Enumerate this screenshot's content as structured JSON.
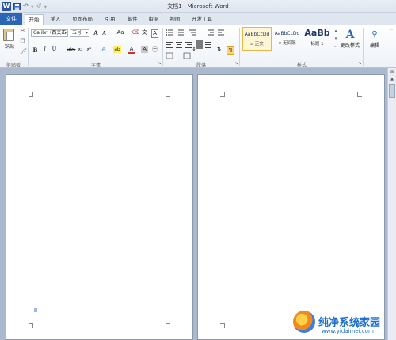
{
  "window": {
    "title": "文档1 - Microsoft Word"
  },
  "qat": {
    "app_icon": "W",
    "undo": "↶",
    "redo": "↺",
    "customize": "▾"
  },
  "tabs": [
    {
      "label": "文件"
    },
    {
      "label": "开始"
    },
    {
      "label": "插入"
    },
    {
      "label": "页面布局"
    },
    {
      "label": "引用"
    },
    {
      "label": "邮件"
    },
    {
      "label": "审阅"
    },
    {
      "label": "视图"
    },
    {
      "label": "开发工具"
    }
  ],
  "ribbon": {
    "clipboard": {
      "paste_label": "粘贴",
      "group_label": "剪贴板"
    },
    "font": {
      "font_name": "Calibri (西文正",
      "font_size": "五号",
      "grow": "A",
      "shrink": "A",
      "change_case": "Aa",
      "clear_format": "⌫",
      "phonetic": "文",
      "border_char": "A",
      "bold": "B",
      "italic": "I",
      "underline": "U",
      "strike": "abc",
      "subscript": "x₂",
      "superscript": "x²",
      "text_effect": "A",
      "highlight": "ab",
      "font_color": "A",
      "char_shading": "A",
      "enclose": "㊀",
      "group_label": "字体"
    },
    "paragraph": {
      "group_label": "段落"
    },
    "styles": {
      "items": [
        {
          "sample": "AaBbCcDd",
          "name": "▫ 正文"
        },
        {
          "sample": "AaBbCcDd",
          "name": "▫ 无间隔"
        },
        {
          "sample": "AaBb",
          "name": "标题 1"
        }
      ],
      "change_styles": "更改样式",
      "group_label": "样式"
    },
    "editing": {
      "label": "编辑"
    }
  },
  "watermark": {
    "title": "纯净系统家园",
    "url": "www.yidaimei.com"
  },
  "colors": {
    "file_tab": "#2b65b3",
    "doc_background": "#abb9cf",
    "accent": "#2b579a"
  }
}
